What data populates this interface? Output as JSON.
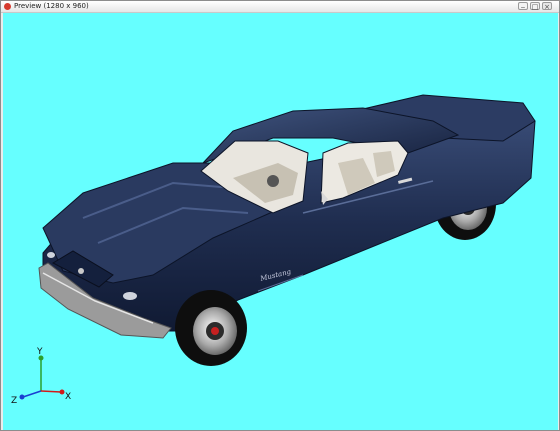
{
  "window": {
    "title": "Preview (1280 x 960)",
    "icon": "app-logo-icon",
    "controls": [
      "minimize-icon",
      "maximize-icon",
      "close-icon"
    ]
  },
  "viewport": {
    "background": "#66ffff",
    "car_color": "#1f2d4f",
    "badge_text": "Mustang"
  },
  "axis_gizmo": {
    "x_label": "X",
    "y_label": "Y",
    "z_label": "Z",
    "x_color": "#d11a1a",
    "y_color": "#2ca02c",
    "z_color": "#1a3fd1"
  }
}
